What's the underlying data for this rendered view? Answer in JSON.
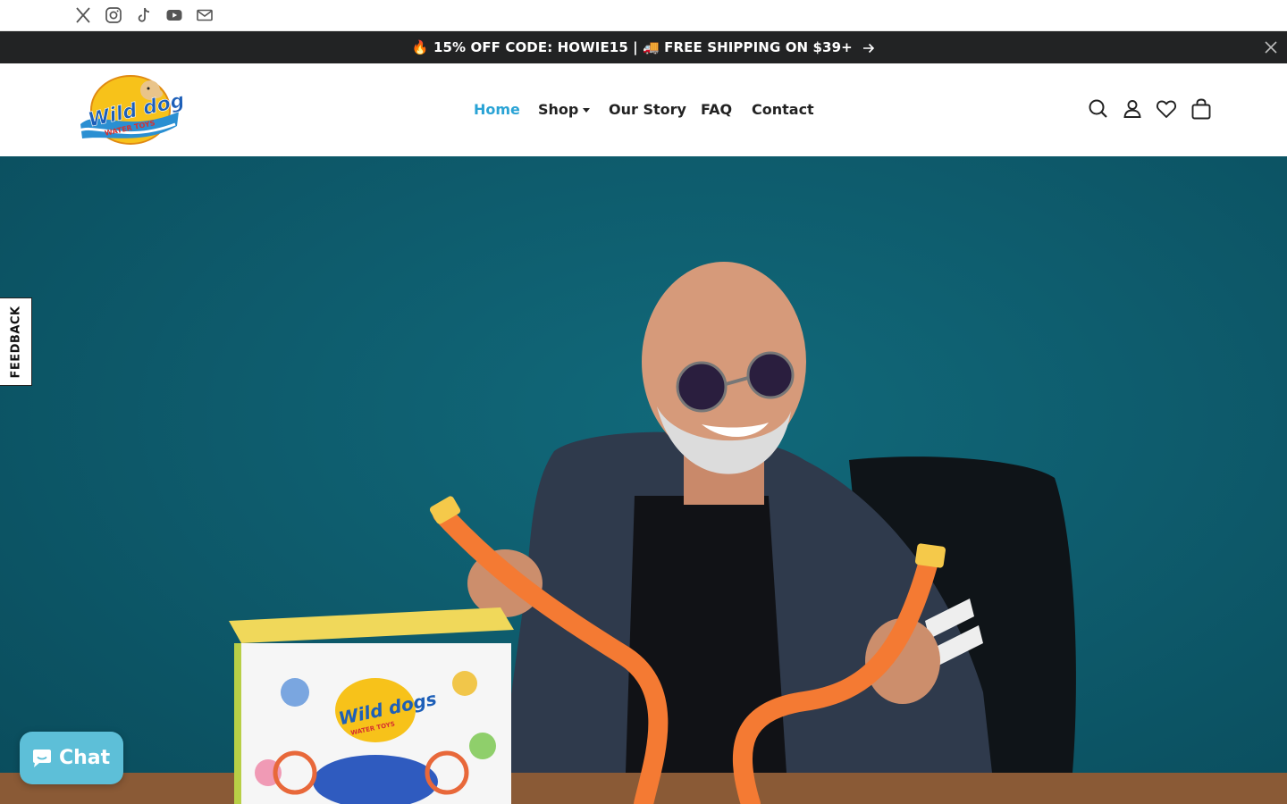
{
  "social": {
    "icons": [
      "x-icon",
      "instagram-icon",
      "tiktok-icon",
      "youtube-icon",
      "email-icon"
    ]
  },
  "announcement": {
    "text": "🔥 15% OFF CODE: HOWIE15 | 🚚 FREE SHIPPING ON $39+",
    "background": "#222324"
  },
  "header": {
    "logo_text": "Wild dogs",
    "logo_subtext": "WATER TOYS",
    "nav": [
      {
        "label": "Home",
        "active": true
      },
      {
        "label": "Shop",
        "has_dropdown": true
      },
      {
        "label": "Our Story"
      },
      {
        "label": "FAQ"
      },
      {
        "label": "Contact"
      }
    ],
    "icons": [
      "search-icon",
      "account-icon",
      "wishlist-icon",
      "cart-icon"
    ],
    "accent_color": "#2aa3d5"
  },
  "hero": {
    "background": "#0e5c6d",
    "box_brand": "Wild dogs",
    "box_subtext": "WATER TOYS"
  },
  "feedback": {
    "label": "FEEDBACK"
  },
  "chat": {
    "label": "Chat",
    "color": "#5dbfd8"
  }
}
